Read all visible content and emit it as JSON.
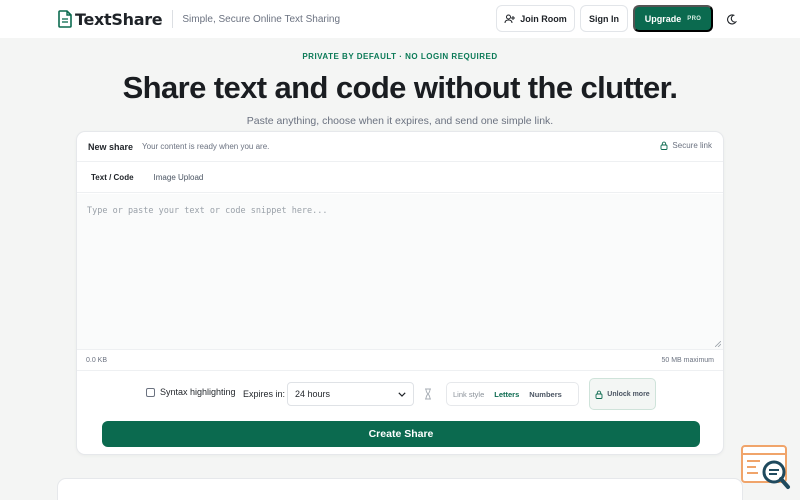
{
  "header": {
    "brand_name": "TextShare",
    "tagline": "Simple, Secure Online Text Sharing",
    "join_room_label": "Join Room",
    "sign_in_label": "Sign In",
    "upgrade_label": "Upgrade",
    "pro_badge": "PRO"
  },
  "hero": {
    "eyebrow": "PRIVATE BY DEFAULT · NO LOGIN REQUIRED",
    "title": "Share text and code without the clutter.",
    "subtitle": "Paste anything, choose when it expires, and send one simple link."
  },
  "card": {
    "title": "New share",
    "subtitle": "Your content is ready when you are.",
    "secure_link_label": "Secure link",
    "tabs": [
      {
        "label": "Text / Code",
        "active": true
      },
      {
        "label": "Image Upload",
        "active": false
      }
    ],
    "editor": {
      "value": "",
      "placeholder": "Type or paste your text or code snippet here..."
    },
    "size_used": "0.0 KB",
    "size_max": "50 MB maximum",
    "options": {
      "syntax_label": "Syntax highlighting",
      "syntax_checked": false,
      "expires_label": "Expires in:",
      "expires_value": "24 hours",
      "link_style_label": "Link style",
      "link_style_options": [
        "Letters",
        "Numbers"
      ],
      "link_style_selected": "Letters",
      "unlock_label": "Unlock more"
    },
    "create_label": "Create Share"
  },
  "colors": {
    "accent": "#0b6a4f",
    "eyebrow": "#0b7a57",
    "background": "#f4f5f4"
  }
}
